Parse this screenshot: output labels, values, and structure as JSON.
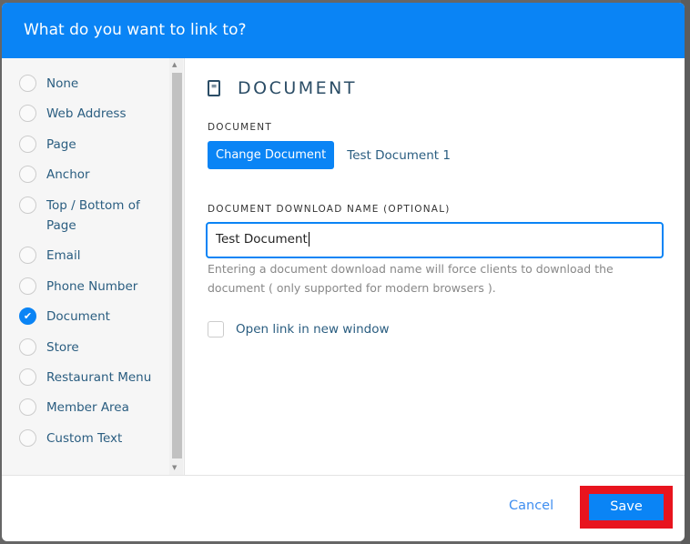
{
  "header": {
    "title": "What do you want to link to?"
  },
  "options": [
    {
      "label": "None",
      "selected": false
    },
    {
      "label": "Web Address",
      "selected": false
    },
    {
      "label": "Page",
      "selected": false
    },
    {
      "label": "Anchor",
      "selected": false
    },
    {
      "label": "Top / Bottom of Page",
      "selected": false
    },
    {
      "label": "Email",
      "selected": false
    },
    {
      "label": "Phone Number",
      "selected": false
    },
    {
      "label": "Document",
      "selected": true
    },
    {
      "label": "Store",
      "selected": false
    },
    {
      "label": "Restaurant Menu",
      "selected": false
    },
    {
      "label": "Member Area",
      "selected": false
    },
    {
      "label": "Custom Text",
      "selected": false
    }
  ],
  "main": {
    "title": "DOCUMENT",
    "document_label": "DOCUMENT",
    "change_button": "Change Document",
    "document_name": "Test Document 1",
    "download_label": "DOCUMENT DOWNLOAD NAME (OPTIONAL)",
    "download_value": "Test Document",
    "help": "Entering a document download name will force clients to download the document ( only supported for modern browsers ).",
    "new_window_label": "Open link in new window",
    "new_window_checked": false
  },
  "footer": {
    "cancel": "Cancel",
    "save": "Save"
  },
  "colors": {
    "accent": "#0a84f5",
    "highlight": "#e8141e"
  }
}
